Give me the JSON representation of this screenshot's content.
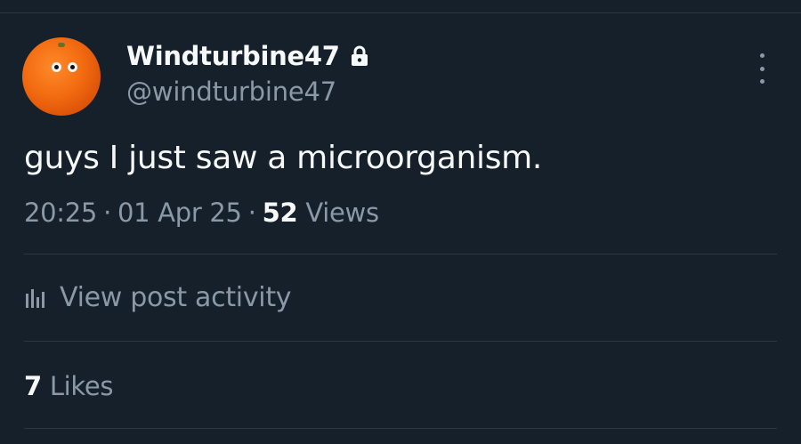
{
  "author": {
    "display_name": "Windturbine47",
    "handle": "@windturbine47",
    "protected_icon": "lock-icon",
    "avatar": "orange-with-googly-eyes"
  },
  "post": {
    "text": "guys I just saw a microorganism.",
    "time": "20:25",
    "date": "01 Apr 25",
    "separator": "·",
    "views_count": "52",
    "views_label": "Views"
  },
  "activity": {
    "icon": "bar-chart-icon",
    "label": "View post activity"
  },
  "likes": {
    "count": "7",
    "label": "Likes"
  },
  "more_menu_icon": "more-vertical-icon",
  "colors": {
    "background": "#15202b",
    "primary_text": "#f7f9f9",
    "secondary_text": "#8b98a5",
    "divider": "#2c3640"
  }
}
